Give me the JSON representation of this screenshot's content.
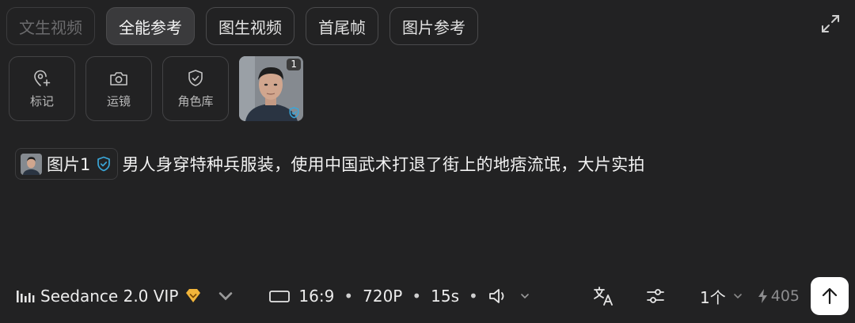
{
  "tabs": [
    {
      "label": "文生视频",
      "state": "disabled"
    },
    {
      "label": "全能参考",
      "state": "active"
    },
    {
      "label": "图生视频",
      "state": "normal"
    },
    {
      "label": "首尾帧",
      "state": "normal"
    },
    {
      "label": "图片参考",
      "state": "normal"
    }
  ],
  "tools": [
    {
      "label": "标记",
      "icon": "map-pin-plus-icon"
    },
    {
      "label": "运镜",
      "icon": "camera-icon"
    },
    {
      "label": "角色库",
      "icon": "shield-check-icon"
    }
  ],
  "reference_image": {
    "badge": "1"
  },
  "prompt": {
    "ref_label": "图片1",
    "text": "男人身穿特种兵服装，使用中国武术打退了街上的地痞流氓，大片实拍"
  },
  "bottom": {
    "model_name": "Seedance 2.0 VIP",
    "aspect": "16:9",
    "resolution": "720P",
    "duration": "15s",
    "separator": "•",
    "count": "1个",
    "credits": "405"
  },
  "colors": {
    "background": "#222223",
    "accent_shield": "#3aa6d8",
    "vip_badge": "#f2b53a"
  }
}
